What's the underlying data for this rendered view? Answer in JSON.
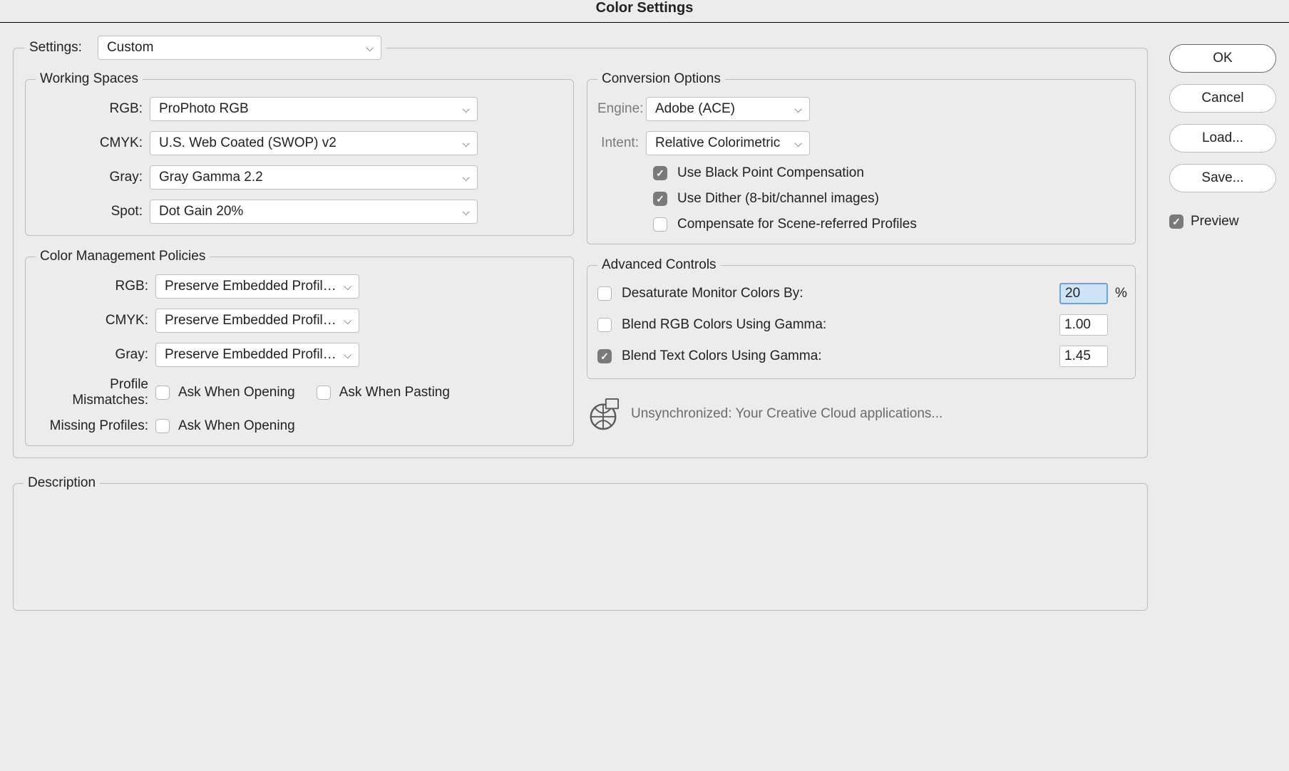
{
  "title": "Color Settings",
  "settings_label": "Settings:",
  "settings_value": "Custom",
  "buttons": {
    "ok": "OK",
    "cancel": "Cancel",
    "load": "Load...",
    "save": "Save..."
  },
  "preview_label": "Preview",
  "preview_checked": true,
  "working_spaces": {
    "legend": "Working Spaces",
    "rows": {
      "rgb": {
        "label": "RGB:",
        "value": "ProPhoto RGB"
      },
      "cmyk": {
        "label": "CMYK:",
        "value": "U.S. Web Coated (SWOP) v2"
      },
      "gray": {
        "label": "Gray:",
        "value": "Gray Gamma 2.2"
      },
      "spot": {
        "label": "Spot:",
        "value": "Dot Gain 20%"
      }
    }
  },
  "policies": {
    "legend": "Color Management Policies",
    "rows": {
      "rgb": {
        "label": "RGB:",
        "value": "Preserve Embedded Profiles"
      },
      "cmyk": {
        "label": "CMYK:",
        "value": "Preserve Embedded Profiles"
      },
      "gray": {
        "label": "Gray:",
        "value": "Preserve Embedded Profiles"
      }
    },
    "profile_mismatches_label": "Profile Mismatches:",
    "ask_when_opening": "Ask When Opening",
    "ask_when_pasting": "Ask When Pasting",
    "missing_profiles_label": "Missing Profiles:",
    "mismatch_open_checked": false,
    "mismatch_paste_checked": false,
    "missing_open_checked": false
  },
  "conversion": {
    "legend": "Conversion Options",
    "engine_label": "Engine:",
    "engine_value": "Adobe (ACE)",
    "intent_label": "Intent:",
    "intent_value": "Relative Colorimetric",
    "bpc_label": "Use Black Point Compensation",
    "bpc_checked": true,
    "dither_label": "Use Dither (8-bit/channel images)",
    "dither_checked": true,
    "scene_label": "Compensate for Scene-referred Profiles",
    "scene_checked": false
  },
  "advanced": {
    "legend": "Advanced Controls",
    "desat_label": "Desaturate Monitor Colors By:",
    "desat_checked": false,
    "desat_value": "20",
    "desat_suffix": "%",
    "blend_rgb_label": "Blend RGB Colors Using Gamma:",
    "blend_rgb_checked": false,
    "blend_rgb_value": "1.00",
    "blend_text_label": "Blend Text Colors Using Gamma:",
    "blend_text_checked": true,
    "blend_text_value": "1.45"
  },
  "status_text": "Unsynchronized: Your Creative Cloud applications...",
  "description_legend": "Description"
}
